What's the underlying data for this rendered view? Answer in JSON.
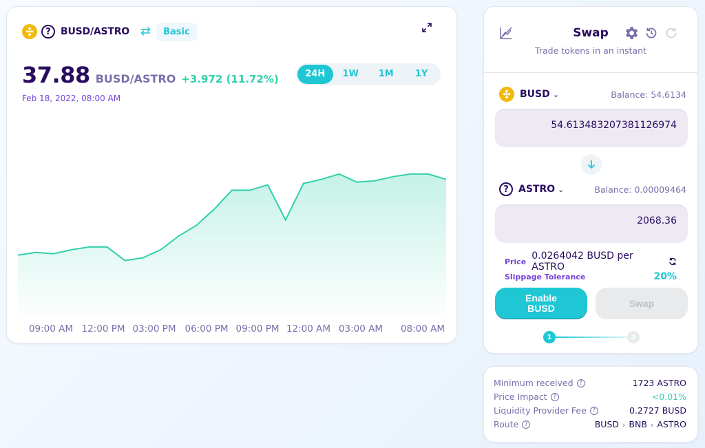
{
  "chart_header": {
    "pair": "BUSD/ASTRO",
    "mode_label": "Basic",
    "price": "37.88",
    "price_pair": "BUSD/ASTRO",
    "change": "+3.972 (11.72%)",
    "date": "Feb 18, 2022, 08:00 AM",
    "timeframes": [
      "24H",
      "1W",
      "1M",
      "1Y"
    ],
    "active_timeframe": "24H"
  },
  "chart_data": {
    "type": "area",
    "xlabel": "",
    "ylabel": "",
    "x_ticks": [
      "09:00 AM",
      "12:00 PM",
      "03:00 PM",
      "06:00 PM",
      "09:00 PM",
      "12:00 AM",
      "03:00 AM",
      "08:00 AM"
    ],
    "values": [
      33.9,
      34.0,
      33.95,
      34.1,
      34.2,
      34.2,
      33.7,
      33.8,
      34.1,
      34.6,
      35.0,
      35.6,
      36.3,
      36.3,
      36.5,
      35.2,
      36.55,
      36.7,
      36.9,
      36.6,
      36.65,
      36.8,
      36.9,
      36.9,
      36.7
    ],
    "y_range": [
      31.5,
      38.5
    ],
    "line_color": "#31d0aa",
    "grid": false
  },
  "swap": {
    "title": "Swap",
    "subtitle": "Trade tokens in an instant",
    "from": {
      "symbol": "BUSD",
      "balance": "Balance: 54.6134",
      "amount": "54.613483207381126974"
    },
    "to": {
      "symbol": "ASTRO",
      "balance": "Balance: 0.00009464",
      "amount": "2068.36"
    },
    "price_label": "Price",
    "price_value": "0.0264042 BUSD per ASTRO",
    "slippage_label": "Slippage Tolerance",
    "slippage_value": "20%",
    "enable_button": "Enable BUSD",
    "swap_button": "Swap",
    "steps": [
      "1",
      "2"
    ]
  },
  "details": {
    "rows": [
      {
        "label": "Minimum received",
        "value": "1723 ASTRO"
      },
      {
        "label": "Price Impact",
        "value": "<0.01%"
      },
      {
        "label": "Liquidity Provider Fee",
        "value": "0.2727 BUSD"
      },
      {
        "label": "Route",
        "value": ""
      }
    ],
    "route": [
      "BUSD",
      "BNB",
      "ASTRO"
    ]
  },
  "colors": {
    "primary": "#1fc7d4",
    "success": "#31d0aa",
    "text": "#280d5f",
    "text_subtle": "#7a6eaa",
    "secondary": "#7645d9",
    "busd": "#f0b90b"
  }
}
